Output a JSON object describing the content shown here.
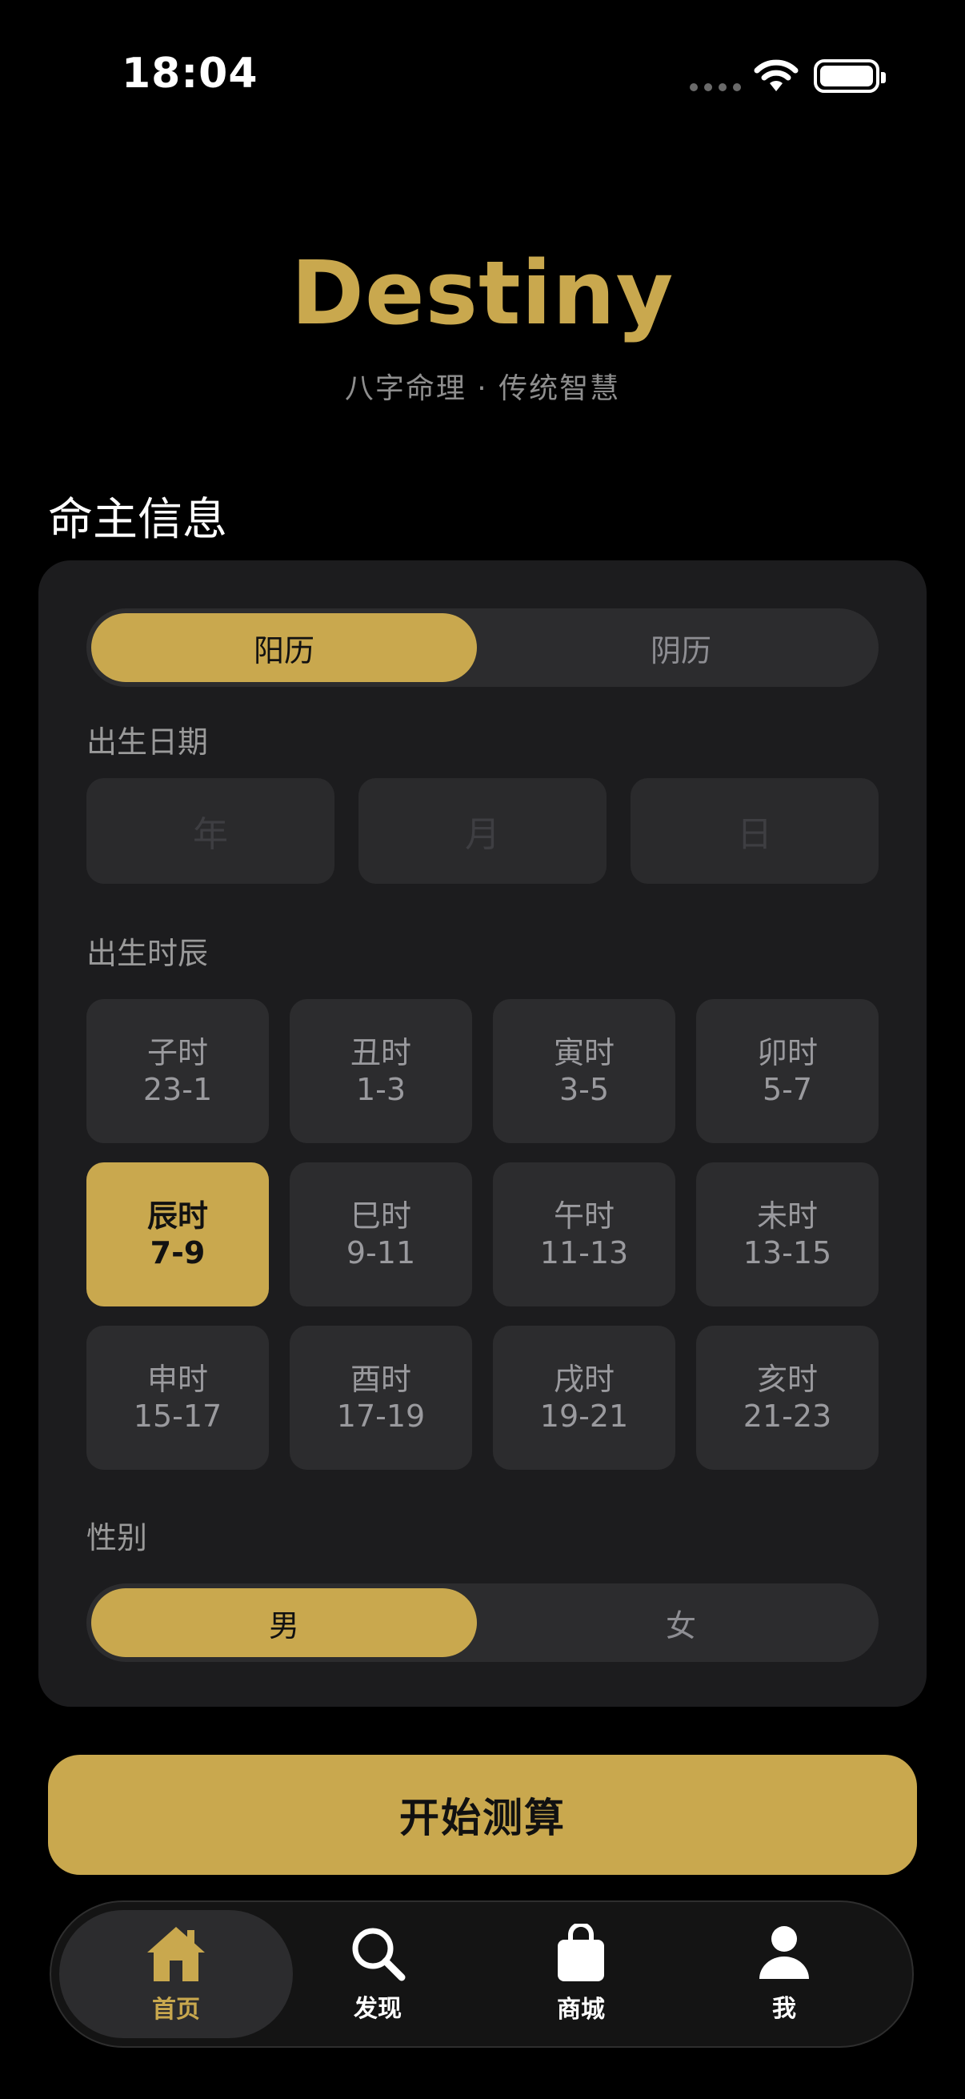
{
  "status": {
    "time": "18:04"
  },
  "header": {
    "title": "Destiny",
    "subtitle": "八字命理 · 传统智慧"
  },
  "section_title": "命主信息",
  "calendar": {
    "options": [
      "阳历",
      "阴历"
    ],
    "selected": "阳历"
  },
  "birth_date": {
    "label": "出生日期",
    "year_placeholder": "年",
    "month_placeholder": "月",
    "day_placeholder": "日"
  },
  "birth_hour": {
    "label": "出生时辰",
    "selected": "辰时",
    "cells": [
      {
        "name": "子时",
        "range": "23-1"
      },
      {
        "name": "丑时",
        "range": "1-3"
      },
      {
        "name": "寅时",
        "range": "3-5"
      },
      {
        "name": "卯时",
        "range": "5-7"
      },
      {
        "name": "辰时",
        "range": "7-9"
      },
      {
        "name": "巳时",
        "range": "9-11"
      },
      {
        "name": "午时",
        "range": "11-13"
      },
      {
        "name": "未时",
        "range": "13-15"
      },
      {
        "name": "申时",
        "range": "15-17"
      },
      {
        "name": "酉时",
        "range": "17-19"
      },
      {
        "name": "戌时",
        "range": "19-21"
      },
      {
        "name": "亥时",
        "range": "21-23"
      }
    ]
  },
  "gender": {
    "label": "性别",
    "options": [
      "男",
      "女"
    ],
    "selected": "男"
  },
  "start_button": "开始测算",
  "tabbar": {
    "items": [
      {
        "label": "首页",
        "icon": "home-icon"
      },
      {
        "label": "发现",
        "icon": "search-icon"
      },
      {
        "label": "商城",
        "icon": "shopping-bag-icon"
      },
      {
        "label": "我",
        "icon": "person-icon"
      }
    ],
    "active": "首页"
  },
  "colors": {
    "accent": "#c9a84e",
    "background": "#000000",
    "card": "#1c1c1e",
    "cell": "#2c2c2e"
  }
}
